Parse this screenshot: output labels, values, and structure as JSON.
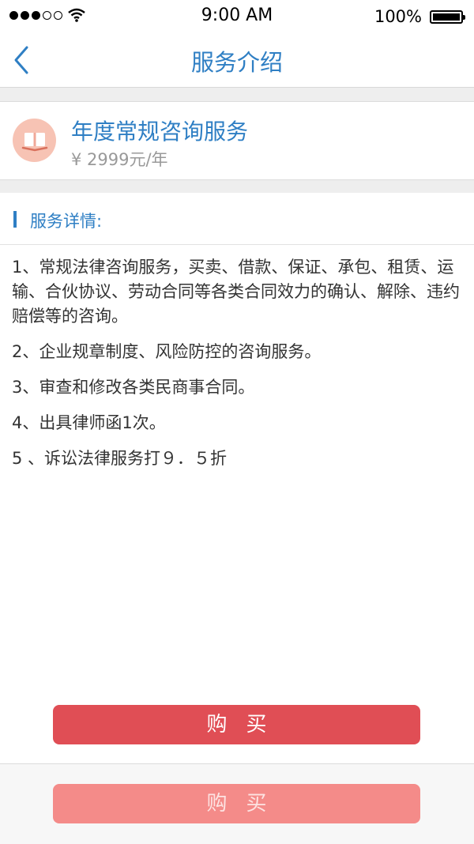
{
  "status_bar": {
    "time": "9:00 AM",
    "battery_percent": "100%",
    "signal_strength": 3,
    "signal_max": 5,
    "wifi_icon": "wifi-icon",
    "battery_icon": "battery-icon"
  },
  "nav": {
    "title": "服务介绍",
    "back_icon": "chevron-left-icon",
    "accent_color": "#2f7fc4"
  },
  "service": {
    "icon": "book-icon",
    "name": "年度常规咨询服务",
    "price": "¥ 2999元/年"
  },
  "details": {
    "title": "服务详情:",
    "items": [
      "1、常规法律咨询服务，买卖、借款、保证、承包、租赁、运输、合伙协议、劳动合同等各类合同效力的确认、解除、违约赔偿等的咨询。",
      "2、企业规章制度、风险防控的咨询服务。",
      "3、审查和修改各类民商事合同。",
      "4、出具律师函1次。",
      "5 、诉讼法律服务打９．５折"
    ]
  },
  "buttons": {
    "primary_label": "购买",
    "primary_color": "#e04e55",
    "secondary_label": "购买",
    "secondary_color": "#f48b89"
  }
}
